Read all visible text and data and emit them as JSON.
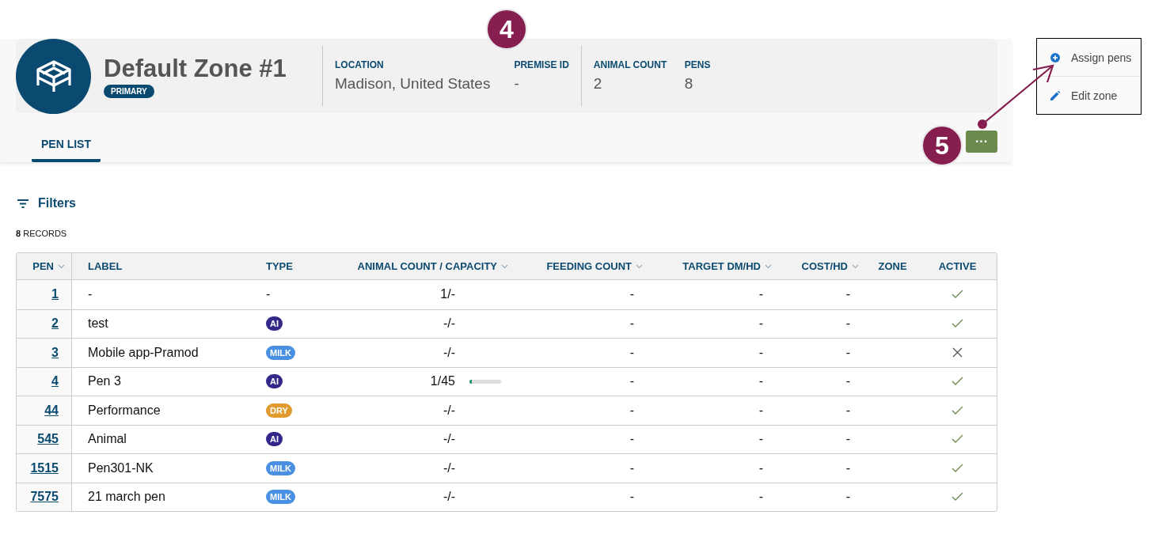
{
  "zone": {
    "title": "Default Zone #1",
    "badge": "PRIMARY",
    "stat_groups": [
      [
        {
          "label": "LOCATION",
          "value": "Madison, United States"
        },
        {
          "label": "PREMISE ID",
          "value": "-"
        }
      ],
      [
        {
          "label": "ANIMAL COUNT",
          "value": "2"
        },
        {
          "label": "PENS",
          "value": "8"
        }
      ]
    ]
  },
  "tabs": [
    {
      "label": "PEN LIST",
      "selected": true
    }
  ],
  "more_button": {
    "label": "···"
  },
  "filters": {
    "label": "Filters"
  },
  "records": "**8** RECORDS",
  "table": {
    "columns": [
      {
        "label": "PEN",
        "sortable": true
      },
      {
        "label": "LABEL",
        "sortable": false
      },
      {
        "label": "TYPE",
        "sortable": false
      },
      {
        "label": "ANIMAL COUNT / CAPACITY",
        "sortable": true
      },
      {
        "label": "FEEDING COUNT",
        "sortable": true
      },
      {
        "label": "TARGET DM/HD",
        "sortable": true
      },
      {
        "label": "COST/HD",
        "sortable": true
      },
      {
        "label": "ZONE",
        "sortable": false
      },
      {
        "label": "ACTIVE",
        "sortable": false
      }
    ],
    "rows": [
      {
        "pen": "1",
        "label": "-",
        "type": {
          "text": "-"
        },
        "count": "1/-",
        "feeding": "-",
        "target": "-",
        "cost": "-",
        "active": true
      },
      {
        "pen": "2",
        "label": "test",
        "type": {
          "text": "AI",
          "color": "#33288a"
        },
        "count": "-/-",
        "feeding": "-",
        "target": "-",
        "cost": "-",
        "active": true
      },
      {
        "pen": "3",
        "label": "Mobile app-Pramod",
        "type": {
          "text": "MILK",
          "color": "#4a90e2"
        },
        "count": "-/-",
        "feeding": "-",
        "target": "-",
        "cost": "-",
        "active": false
      },
      {
        "pen": "4",
        "label": "Pen 3",
        "type": {
          "text": "AI",
          "color": "#33288a"
        },
        "count": "1/45",
        "level": 0.03,
        "feeding": "-",
        "target": "-",
        "cost": "-",
        "active": true
      },
      {
        "pen": "44",
        "label": "Performance",
        "type": {
          "text": "DRY",
          "color": "#e09a2e"
        },
        "count": "-/-",
        "feeding": "-",
        "target": "-",
        "cost": "-",
        "active": true
      },
      {
        "pen": "545",
        "label": "Animal",
        "type": {
          "text": "AI",
          "color": "#33288a"
        },
        "count": "-/-",
        "feeding": "-",
        "target": "-",
        "cost": "-",
        "active": true
      },
      {
        "pen": "1515",
        "label": "Pen301-NK",
        "type": {
          "text": "MILK",
          "color": "#4a90e2"
        },
        "count": "-/-",
        "feeding": "-",
        "target": "-",
        "cost": "-",
        "active": true
      },
      {
        "pen": "7575",
        "label": "21 march pen",
        "type": {
          "text": "MILK",
          "color": "#4a90e2"
        },
        "count": "-/-",
        "feeding": "-",
        "target": "-",
        "cost": "-",
        "active": true
      }
    ]
  },
  "menu": {
    "items": [
      {
        "kind": "add",
        "label": "Assign pens"
      },
      {
        "kind": "edit",
        "label": "Edit zone"
      }
    ]
  },
  "annotations": [
    {
      "label": "4"
    },
    {
      "label": "5"
    }
  ]
}
